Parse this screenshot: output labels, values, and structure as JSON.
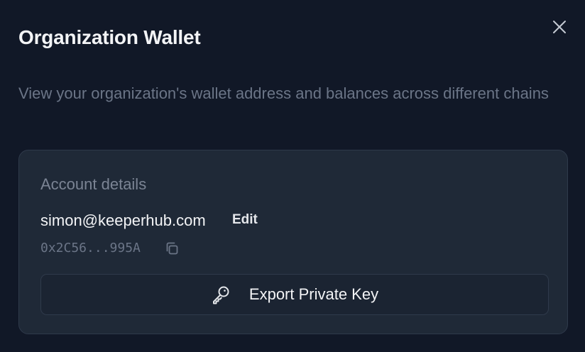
{
  "dialog": {
    "title": "Organization Wallet",
    "subtitle": "View your organization's wallet address and balances across different chains",
    "close_icon": "close-icon"
  },
  "account": {
    "heading": "Account details",
    "email": "simon@keeperhub.com",
    "edit_label": "Edit",
    "address_short": "0x2C56...995A",
    "copy_icon": "copy-icon"
  },
  "export": {
    "label": "Export Private Key",
    "icon": "key-icon"
  },
  "colors": {
    "background": "#111827",
    "card": "#1f2937",
    "border": "#2f3a4b",
    "text_primary": "#f3f4f6",
    "text_muted": "#6b7587"
  }
}
